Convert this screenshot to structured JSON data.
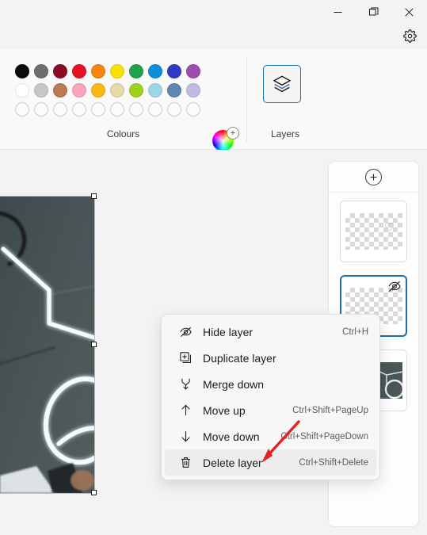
{
  "window": {
    "controls": [
      {
        "name": "minimize",
        "glyph": "minimize-icon"
      },
      {
        "name": "restore",
        "glyph": "restore-icon"
      },
      {
        "name": "close",
        "glyph": "close-icon"
      }
    ],
    "settings_icon": "gear-icon"
  },
  "ribbon": {
    "colours": {
      "label": "Colours",
      "row1": [
        "#0b0b0b",
        "#6e6e6e",
        "#8b0c24",
        "#e81123",
        "#f7840f",
        "#f9e000",
        "#1ea34a",
        "#0b8fdb",
        "#3038c4",
        "#a04bb0"
      ],
      "row2": [
        "#ffffff",
        "#c6c6c6",
        "#b97b51",
        "#f9a3bc",
        "#f9b814",
        "#e5daa8",
        "#9fd219",
        "#9cd6e6",
        "#5f86ad",
        "#c3bae3"
      ],
      "row3_empty_count": 10,
      "color_wheel": {
        "name": "color-wheel-picker",
        "badge": "+"
      }
    },
    "layers": {
      "label": "Layers",
      "button_icon": "layers-stack-icon",
      "selected": true
    }
  },
  "canvas": {
    "selection": {
      "handles": 3
    },
    "image_description": "neon-light-wall-photo"
  },
  "layers_panel": {
    "add_button": {
      "name": "add-layer-button",
      "glyph": "+"
    },
    "layers": [
      {
        "id": "layer-1",
        "type": "transparent",
        "content": "heart",
        "heart_glyph": "♡",
        "selected": false,
        "hidden": false
      },
      {
        "id": "layer-2",
        "type": "transparent",
        "content": "",
        "selected": true,
        "hidden": true
      },
      {
        "id": "layer-3",
        "type": "photo",
        "content": "",
        "selected": false,
        "hidden": false
      }
    ]
  },
  "context_menu": {
    "items": [
      {
        "label": "Hide layer",
        "accel": "Ctrl+H",
        "icon": "eye-slash-icon",
        "highlight": false
      },
      {
        "label": "Duplicate layer",
        "accel": "",
        "icon": "duplicate-icon",
        "highlight": false
      },
      {
        "label": "Merge down",
        "accel": "",
        "icon": "merge-down-icon",
        "highlight": false
      },
      {
        "label": "Move up",
        "accel": "Ctrl+Shift+PageUp",
        "icon": "arrow-up-icon",
        "highlight": false
      },
      {
        "label": "Move down",
        "accel": "Ctrl+Shift+PageDown",
        "icon": "arrow-down-icon",
        "highlight": false
      },
      {
        "label": "Delete layer",
        "accel": "Ctrl+Shift+Delete",
        "icon": "trash-icon",
        "highlight": true
      }
    ]
  },
  "annotation": {
    "arrow_color": "#e32222",
    "points_to": "Delete layer"
  }
}
